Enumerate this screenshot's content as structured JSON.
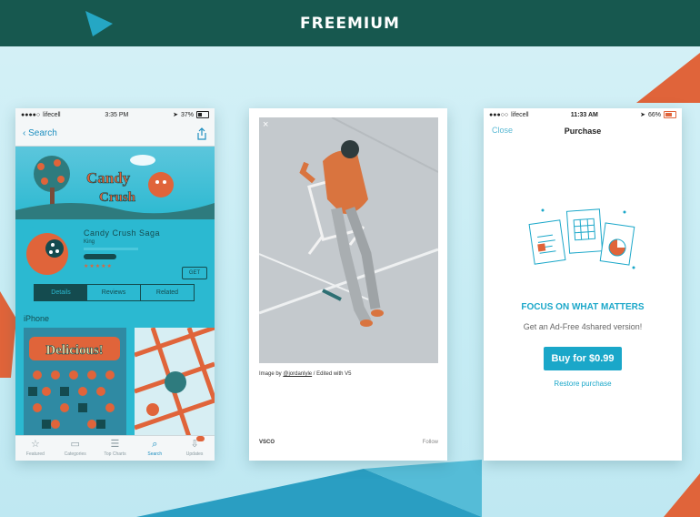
{
  "header": {
    "title": "FREEMIUM"
  },
  "colors": {
    "header_bg": "#17584f",
    "accent_orange": "#e0643a",
    "accent_blue": "#1aa7c9",
    "cyan": "#2bb9d1"
  },
  "phone1": {
    "status": {
      "carrier": "lifecell",
      "time": "3:35 PM",
      "battery": "37%"
    },
    "nav": {
      "back_label": "Search",
      "share_icon": "share-icon"
    },
    "app": {
      "name": "Candy Crush Saga",
      "developer": "King",
      "get_label": "GET"
    },
    "segments": [
      "Details",
      "Reviews",
      "Related"
    ],
    "section_label": "iPhone",
    "screenshot_text": "Delicious!",
    "tabs": [
      {
        "label": "Featured",
        "icon": "star-icon"
      },
      {
        "label": "Categories",
        "icon": "categories-icon"
      },
      {
        "label": "Top Charts",
        "icon": "top-charts-icon"
      },
      {
        "label": "Search",
        "icon": "search-icon"
      },
      {
        "label": "Updates",
        "icon": "updates-icon"
      }
    ]
  },
  "phone2": {
    "caption_prefix": "Image by ",
    "caption_user": "@jordanlyle",
    "caption_suffix": " / Edited with V5",
    "brand": "VSCO",
    "follow_label": "Follow"
  },
  "phone3": {
    "status": {
      "carrier": "lifecell",
      "time": "11:33 AM",
      "battery": "66%"
    },
    "nav": {
      "close_label": "Close",
      "title": "Purchase"
    },
    "headline": "FOCUS ON WHAT MATTERS",
    "subtitle": "Get an Ad-Free 4shared version!",
    "buy_label": "Buy for $0.99",
    "restore_label": "Restore purchase"
  }
}
